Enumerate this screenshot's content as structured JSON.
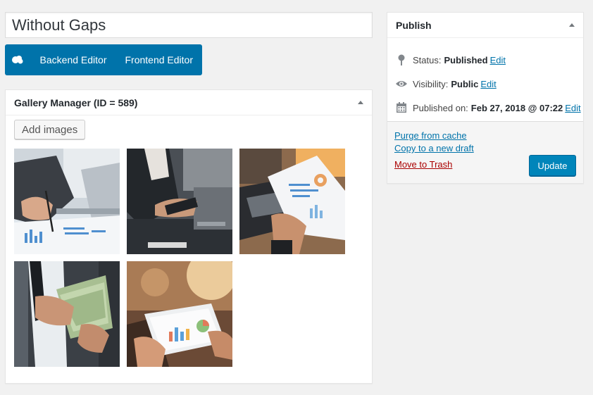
{
  "post": {
    "title": "Without Gaps"
  },
  "editor": {
    "backend_label": "Backend Editor",
    "frontend_label": "Frontend Editor"
  },
  "gallery": {
    "title": "Gallery Manager (ID = 589)",
    "add_images_label": "Add images",
    "images": [
      {
        "name": "gallery-image-analysis"
      },
      {
        "name": "gallery-image-meeting"
      },
      {
        "name": "gallery-image-report"
      },
      {
        "name": "gallery-image-money"
      },
      {
        "name": "gallery-image-tablet"
      }
    ]
  },
  "publish": {
    "title": "Publish",
    "status_label": "Status:",
    "status_value": "Published",
    "visibility_label": "Visibility:",
    "visibility_value": "Public",
    "published_label": "Published on:",
    "published_value": "Feb 27, 2018 @ 07:22",
    "edit_label": "Edit",
    "purge_label": "Purge from cache",
    "copy_label": "Copy to a new draft",
    "trash_label": "Move to Trash",
    "update_label": "Update"
  },
  "colors": {
    "accent": "#0073aa",
    "button_primary": "#0085ba",
    "trash": "#a00"
  }
}
